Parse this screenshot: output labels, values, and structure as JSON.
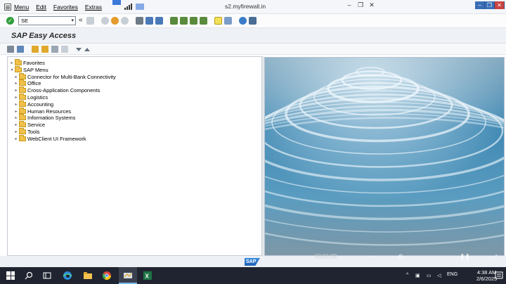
{
  "window": {
    "title": "s2.myfirewall.in",
    "menu": [
      "Menu",
      "Edit",
      "Favorites",
      "Extras"
    ],
    "controls": {
      "minimize": "–",
      "restore": "❐",
      "close": "✕"
    }
  },
  "toolbar": {
    "command_field_value": "SE",
    "collapse_glyph": "«",
    "enter_glyph": "✓"
  },
  "page": {
    "title": "SAP Easy Access"
  },
  "tree": {
    "favorites": {
      "label": "Favorites",
      "expander": "▸"
    },
    "sap_menu": {
      "label": "SAP Menu",
      "expander": "▾"
    },
    "items": [
      {
        "label": "Connector for Multi-Bank Connectivity"
      },
      {
        "label": "Office"
      },
      {
        "label": "Cross-Application Components"
      },
      {
        "label": "Logistics"
      },
      {
        "label": "Accounting"
      },
      {
        "label": "Human Resources"
      },
      {
        "label": "Information Systems"
      },
      {
        "label": "Service"
      },
      {
        "label": "Tools"
      },
      {
        "label": "WebClient UI Framework"
      }
    ],
    "item_expander": "▸"
  },
  "status": {
    "sap_logo_text": "SAP",
    "video_time": "00:01:09"
  },
  "taskbar": {
    "language": "ENG",
    "time": "4:38 AM",
    "date": "2/6/2025"
  },
  "colors": {
    "accent": "#3c78d8",
    "folder": "#f0c048",
    "enter_green": "#2f9e3c"
  }
}
